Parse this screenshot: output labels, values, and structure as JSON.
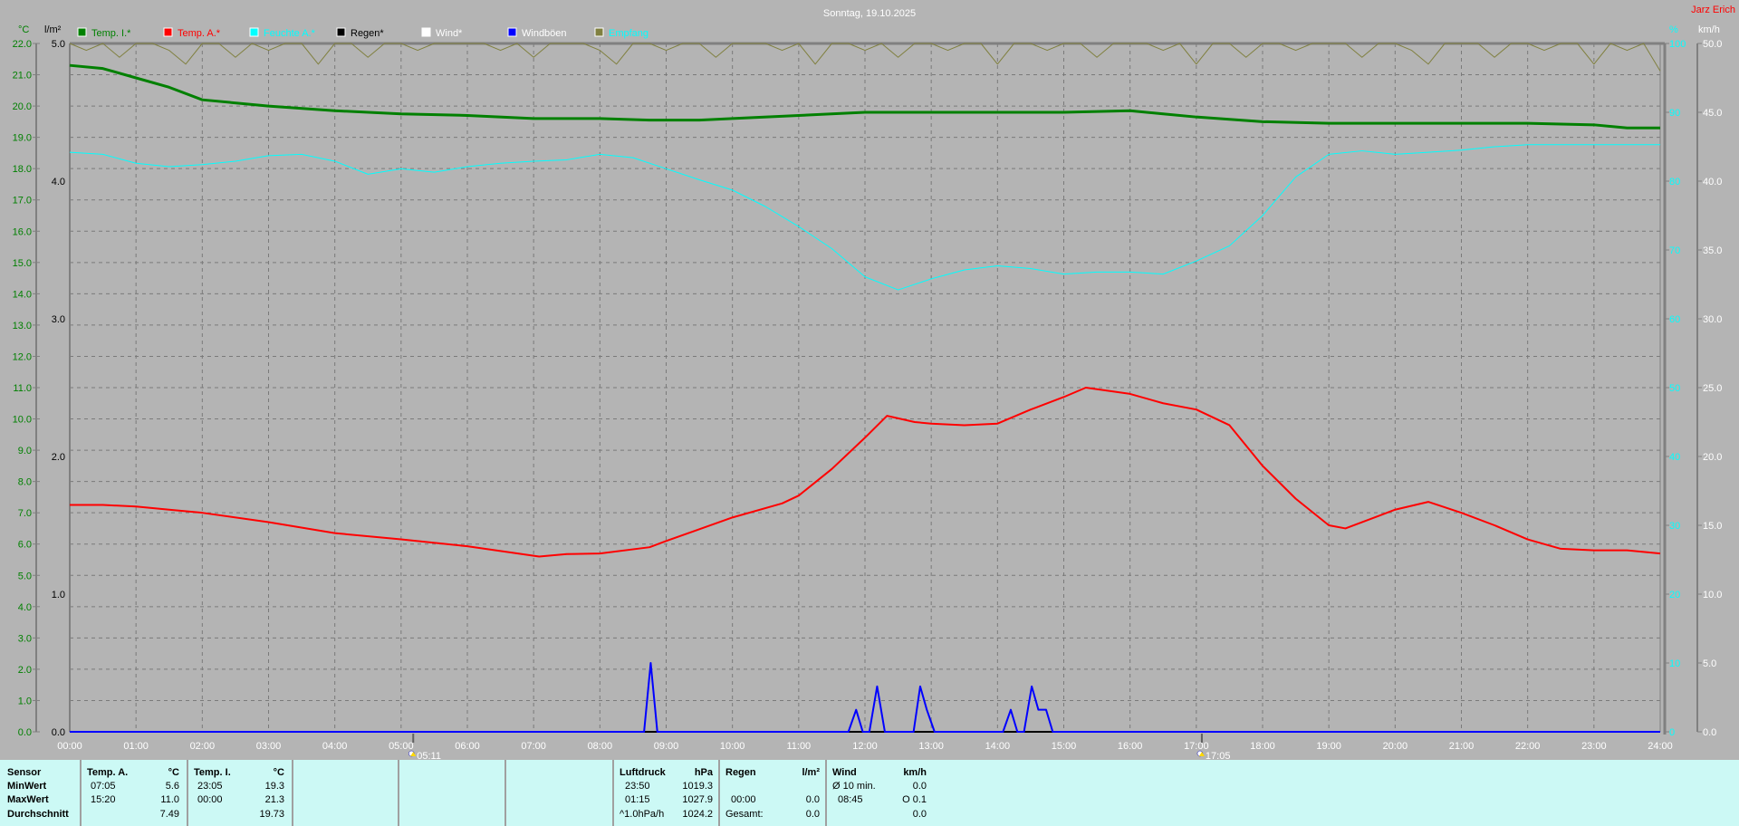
{
  "header": {
    "title": "Sonntag, 19.10.2025",
    "owner": "Jarz Erich"
  },
  "chart_data": {
    "type": "line",
    "title": "Sonntag, 19.10.2025",
    "x_ticks": [
      "00:00",
      "01:00",
      "02:00",
      "03:00",
      "04:00",
      "05:00",
      "06:00",
      "07:00",
      "08:00",
      "09:00",
      "10:00",
      "11:00",
      "12:00",
      "13:00",
      "14:00",
      "15:00",
      "16:00",
      "17:00",
      "18:00",
      "19:00",
      "20:00",
      "21:00",
      "22:00",
      "23:00",
      "24:00"
    ],
    "xlim_hours": [
      0,
      24
    ],
    "grid": true,
    "legend_position": "top",
    "axes": {
      "temp": {
        "unit": "°C",
        "ylim": [
          0,
          22
        ],
        "ticks": [
          "0.0",
          "1.0",
          "2.0",
          "3.0",
          "4.0",
          "5.0",
          "6.0",
          "7.0",
          "8.0",
          "9.0",
          "10.0",
          "11.0",
          "12.0",
          "13.0",
          "14.0",
          "15.0",
          "16.0",
          "17.0",
          "18.0",
          "19.0",
          "20.0",
          "21.0",
          "22.0"
        ],
        "color": "#008000"
      },
      "rain": {
        "unit": "l/m²",
        "ylim": [
          0,
          5
        ],
        "ticks": [
          "0.0",
          "1.0",
          "2.0",
          "3.0",
          "4.0",
          "5.0"
        ],
        "color": "#000000"
      },
      "humidity": {
        "unit": "%",
        "ylim": [
          0,
          100
        ],
        "ticks": [
          "0",
          "10",
          "20",
          "30",
          "40",
          "50",
          "60",
          "70",
          "80",
          "90",
          "100"
        ],
        "color": "#00ffff"
      },
      "wind": {
        "unit": "km/h",
        "ylim": [
          0,
          50
        ],
        "ticks": [
          "0.0",
          "5.0",
          "10.0",
          "15.0",
          "20.0",
          "25.0",
          "30.0",
          "35.0",
          "40.0",
          "45.0",
          "50.0"
        ],
        "color": "#ffffff"
      }
    },
    "legend": [
      {
        "name": "Temp. I.*",
        "color": "#008000"
      },
      {
        "name": "Temp. A.*",
        "color": "#ff0000"
      },
      {
        "name": "Feuchte A.*",
        "color": "#00ffff"
      },
      {
        "name": "Regen*",
        "color": "#000000"
      },
      {
        "name": "Wind*",
        "color": "#ffffff"
      },
      {
        "name": "Windböen",
        "color": "#0000ff"
      },
      {
        "name": "Empfang",
        "color": "#808040"
      }
    ],
    "series": [
      {
        "name": "Temp. I.*",
        "axis": "temp",
        "color": "#008000",
        "width": 3,
        "x": [
          "00:00",
          "00:30",
          "01:00",
          "01:30",
          "02:00",
          "03:00",
          "04:00",
          "05:00",
          "06:00",
          "07:00",
          "08:00",
          "08:45",
          "09:30",
          "10:00",
          "11:00",
          "12:00",
          "13:00",
          "14:00",
          "15:00",
          "16:00",
          "16:30",
          "17:00",
          "18:00",
          "19:00",
          "20:00",
          "21:00",
          "22:00",
          "23:00",
          "23:30",
          "24:00"
        ],
        "y": [
          21.3,
          21.2,
          20.9,
          20.6,
          20.2,
          20.0,
          19.85,
          19.75,
          19.7,
          19.6,
          19.6,
          19.55,
          19.55,
          19.6,
          19.7,
          19.8,
          19.8,
          19.8,
          19.8,
          19.85,
          19.75,
          19.65,
          19.5,
          19.45,
          19.45,
          19.45,
          19.45,
          19.4,
          19.3,
          19.3
        ]
      },
      {
        "name": "Temp. A.*",
        "axis": "temp",
        "color": "#ff0000",
        "width": 2,
        "x": [
          "00:00",
          "00:30",
          "01:00",
          "01:30",
          "02:00",
          "03:00",
          "04:00",
          "05:00",
          "06:00",
          "07:05",
          "07:30",
          "08:00",
          "08:45",
          "09:00",
          "10:00",
          "10:45",
          "11:00",
          "11:30",
          "12:00",
          "12:20",
          "12:45",
          "13:00",
          "13:30",
          "14:00",
          "14:30",
          "15:00",
          "15:20",
          "16:00",
          "16:30",
          "17:00",
          "17:30",
          "18:00",
          "18:30",
          "19:00",
          "19:15",
          "19:30",
          "20:00",
          "20:30",
          "21:00",
          "21:30",
          "22:00",
          "22:30",
          "23:00",
          "23:30",
          "24:00"
        ],
        "y": [
          7.25,
          7.25,
          7.2,
          7.1,
          7.0,
          6.7,
          6.35,
          6.15,
          5.93,
          5.6,
          5.68,
          5.7,
          5.9,
          6.1,
          6.85,
          7.3,
          7.55,
          8.4,
          9.4,
          10.1,
          9.9,
          9.85,
          9.8,
          9.85,
          10.3,
          10.7,
          11.0,
          10.8,
          10.5,
          10.3,
          9.8,
          8.5,
          7.45,
          6.6,
          6.5,
          6.7,
          7.1,
          7.35,
          7.0,
          6.6,
          6.15,
          5.85,
          5.8,
          5.8,
          5.7
        ]
      },
      {
        "name": "Feuchte A.*",
        "axis": "humidity",
        "color": "#00ffff",
        "width": 1,
        "x": [
          "00:00",
          "00:30",
          "01:00",
          "01:30",
          "02:00",
          "02:30",
          "03:00",
          "03:30",
          "04:00",
          "04:30",
          "05:00",
          "05:30",
          "06:00",
          "06:30",
          "07:00",
          "07:30",
          "08:00",
          "08:30",
          "09:00",
          "09:30",
          "10:00",
          "10:30",
          "11:00",
          "11:30",
          "12:00",
          "12:30",
          "13:00",
          "13:30",
          "14:00",
          "14:30",
          "15:00",
          "15:30",
          "16:00",
          "16:30",
          "17:00",
          "17:30",
          "18:00",
          "18:30",
          "19:00",
          "19:30",
          "20:00",
          "20:30",
          "21:00",
          "21:30",
          "22:00",
          "23:00",
          "24:00"
        ],
        "y": [
          84.2,
          83.9,
          82.6,
          82.1,
          82.4,
          82.9,
          83.7,
          83.9,
          82.9,
          81.0,
          81.8,
          81.3,
          82.1,
          82.6,
          82.9,
          83.1,
          83.9,
          83.4,
          81.8,
          80.2,
          78.7,
          76.3,
          73.4,
          70.2,
          66.1,
          64.2,
          65.8,
          67.1,
          67.7,
          67.3,
          66.5,
          66.8,
          66.8,
          66.5,
          68.4,
          70.6,
          75.0,
          80.6,
          83.9,
          84.4,
          83.9,
          84.2,
          84.5,
          85.0,
          85.3,
          85.3,
          85.3
        ]
      },
      {
        "name": "Windböen",
        "axis": "wind",
        "color": "#0000ff",
        "width": 2,
        "x": [
          "00:00",
          "08:40",
          "08:46",
          "08:52",
          "11:45",
          "11:52",
          "11:58",
          "12:04",
          "12:11",
          "12:18",
          "12:44",
          "12:50",
          "12:56",
          "13:03",
          "14:05",
          "14:12",
          "14:18",
          "14:24",
          "14:31",
          "14:37",
          "14:44",
          "14:50",
          "24:00"
        ],
        "y": [
          0,
          0,
          5.0,
          0,
          0,
          1.6,
          0,
          0,
          3.3,
          0,
          0,
          3.3,
          1.6,
          0,
          0,
          1.6,
          0,
          0,
          3.3,
          1.6,
          1.6,
          0,
          0
        ]
      },
      {
        "name": "Empfang",
        "axis": "humidity",
        "color": "#808040",
        "width": 1,
        "x_step_minutes": 15,
        "y": [
          100,
          99,
          100,
          98,
          100,
          100,
          99,
          97,
          100,
          100,
          98,
          100,
          99,
          100,
          100,
          97,
          100,
          100,
          98,
          100,
          100,
          99,
          100,
          100,
          100,
          100,
          99,
          100,
          98,
          100,
          100,
          100,
          99,
          97,
          100,
          100,
          99,
          100,
          100,
          98,
          100,
          100,
          100,
          99,
          100,
          97,
          100,
          100,
          99,
          100,
          98,
          100,
          100,
          99,
          100,
          100,
          97,
          100,
          100,
          99,
          100,
          100,
          98,
          100,
          100,
          100,
          99,
          100,
          97,
          100,
          100,
          98,
          100,
          100,
          99,
          100,
          100,
          100,
          98,
          100,
          100,
          99,
          97,
          100,
          100,
          100,
          98,
          100,
          100,
          99,
          100,
          100,
          97,
          100,
          99,
          100,
          96
        ]
      }
    ],
    "markers": [
      {
        "label": "05:11",
        "time": "05:11",
        "type": "sunrise"
      },
      {
        "label": "17:05",
        "time": "17:05",
        "type": "sunset"
      }
    ]
  },
  "stats": {
    "row_labels": [
      "Sensor",
      "MinWert",
      "MaxWert",
      "Durchschnitt"
    ],
    "temp_a": {
      "header": "Temp. A.",
      "unit": "°C",
      "min_time": "07:05",
      "min": "5.6",
      "max_time": "15:20",
      "max": "11.0",
      "avg": "7.49"
    },
    "temp_i": {
      "header": "Temp. I.",
      "unit": "°C",
      "min_time": "23:05",
      "min": "19.3",
      "max_time": "00:00",
      "max": "21.3",
      "avg": "19.73"
    },
    "pressure": {
      "header": "Luftdruck",
      "unit": "hPa",
      "min_time": "23:50",
      "min": "1019.3",
      "max_time": "01:15",
      "max": "1027.9",
      "trend": "^1.0hPa/h",
      "current": "1024.2"
    },
    "rain": {
      "header": "Regen",
      "unit": "l/m²",
      "max_time": "00:00",
      "max": "0.0",
      "total_label": "Gesamt:",
      "total": "0.0"
    },
    "wind": {
      "header": "Wind",
      "unit": "km/h",
      "avg_label": "Ø 10 min.",
      "avg": "0.0",
      "max_time": "08:45",
      "max": "O 0.1",
      "current": "0.0"
    }
  }
}
